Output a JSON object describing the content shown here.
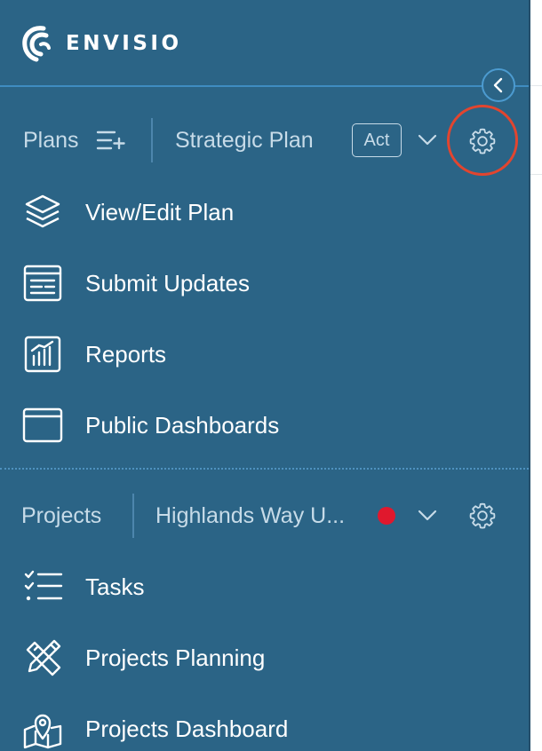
{
  "brand": {
    "name": "ENVISIO"
  },
  "sidebar": {
    "collapse_icon": "chevron-left-icon",
    "plans": {
      "label": "Plans",
      "add_icon": "list-add-icon",
      "selected_plan": "Strategic Plan",
      "status_badge": "Act",
      "dropdown_icon": "chevron-down-icon",
      "settings_icon": "gear-icon",
      "items": [
        {
          "label": "View/Edit Plan",
          "icon": "layers-icon"
        },
        {
          "label": "Submit Updates",
          "icon": "form-icon"
        },
        {
          "label": "Reports",
          "icon": "bar-chart-icon"
        },
        {
          "label": "Public Dashboards",
          "icon": "browser-window-icon"
        }
      ]
    },
    "projects": {
      "label": "Projects",
      "selected_project": "Highlands Way U...",
      "status_color": "#e0182d",
      "dropdown_icon": "chevron-down-icon",
      "settings_icon": "gear-icon",
      "items": [
        {
          "label": "Tasks",
          "icon": "checklist-icon"
        },
        {
          "label": "Projects Planning",
          "icon": "pencil-ruler-icon"
        },
        {
          "label": "Projects Dashboard",
          "icon": "map-pin-icon"
        }
      ]
    }
  },
  "colors": {
    "sidebar_bg": "#2b6486",
    "accent": "#3f8cc1",
    "highlight_ring": "#e2452f",
    "muted_text": "#c7dbe8",
    "status_red": "#e0182d"
  }
}
